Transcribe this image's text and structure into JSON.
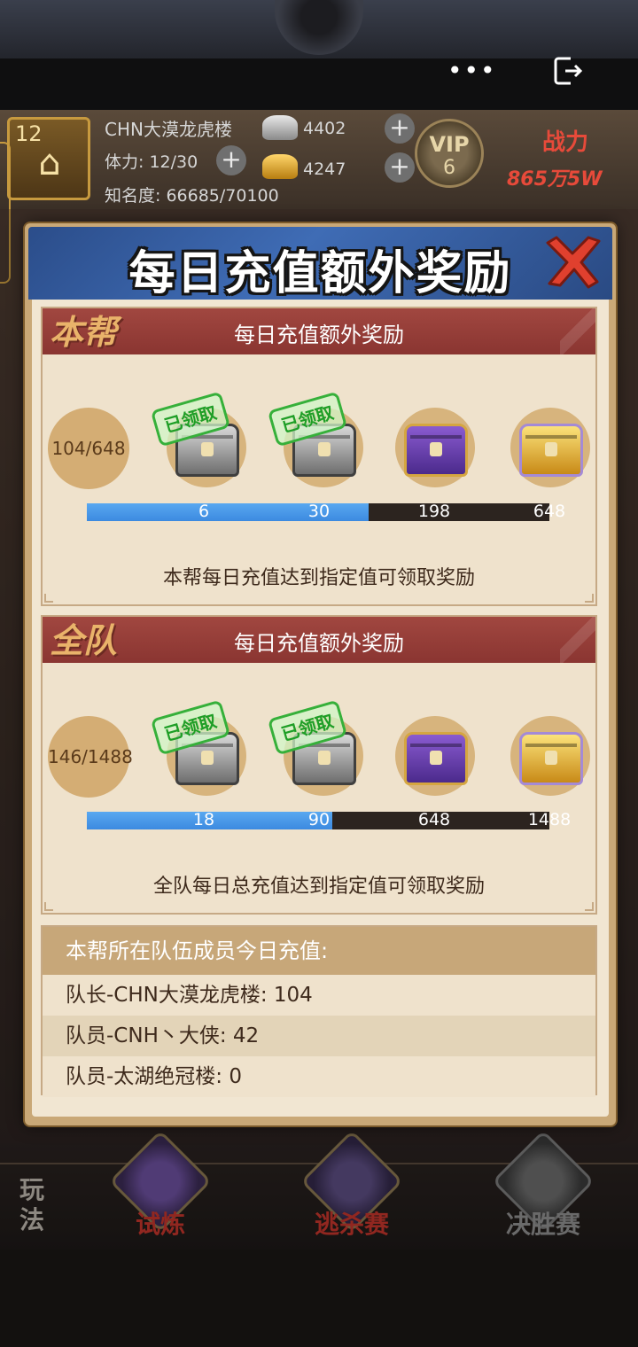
{
  "player": {
    "level": "12",
    "name": "CHN大漠龙虎楼",
    "stamina": "体力: 12/30",
    "fame": "知名度: 66685/70100",
    "silver": "4402",
    "gold": "4247",
    "vip_label": "VIP",
    "vip_level": "6",
    "power_label": "战力",
    "power_value": "865万5W"
  },
  "top_bar": {
    "more_icon": "more-dots-icon",
    "exit_icon": "exit-icon"
  },
  "modal": {
    "title": "每日充值额外奖励",
    "close_icon": "close-x-icon",
    "guild_section": {
      "tag": "本帮",
      "title": "每日充值额外奖励",
      "progress_text": "104/648",
      "progress_value": 104,
      "max_value": 648,
      "fill_fraction": 0.61,
      "ticks": [
        "6",
        "30",
        "198",
        "648"
      ],
      "chests": [
        {
          "type": "silver",
          "claimed": true,
          "stamp": "已领取"
        },
        {
          "type": "silver",
          "claimed": true,
          "stamp": "已领取"
        },
        {
          "type": "purple",
          "claimed": false
        },
        {
          "type": "gold",
          "claimed": false
        }
      ],
      "description": "本帮每日充值达到指定值可领取奖励"
    },
    "team_section": {
      "tag": "全队",
      "title": "每日充值额外奖励",
      "progress_text": "146/1488",
      "progress_value": 146,
      "max_value": 1488,
      "fill_fraction": 0.53,
      "ticks": [
        "18",
        "90",
        "648",
        "1488"
      ],
      "chests": [
        {
          "type": "silver",
          "claimed": true,
          "stamp": "已领取"
        },
        {
          "type": "silver",
          "claimed": true,
          "stamp": "已领取"
        },
        {
          "type": "purple",
          "claimed": false
        },
        {
          "type": "gold",
          "claimed": false
        }
      ],
      "description": "全队每日总充值达到指定值可领取奖励"
    },
    "members": {
      "header": "本帮所在队伍成员今日充值:",
      "rows": [
        "队长-CHN大漠龙虎楼: 104",
        "队员-CNH丶大侠: 42",
        "队员-太湖绝冠楼: 0"
      ]
    }
  },
  "bottom_nav": {
    "section_label": "玩法",
    "items": [
      "试炼",
      "逃杀赛",
      "决胜赛"
    ]
  },
  "colors": {
    "progress_fill": "#3c8ae0",
    "section_header": "#8a3531",
    "claimed_stamp": "#36b03a",
    "modal_header": "#3f6cb5"
  }
}
